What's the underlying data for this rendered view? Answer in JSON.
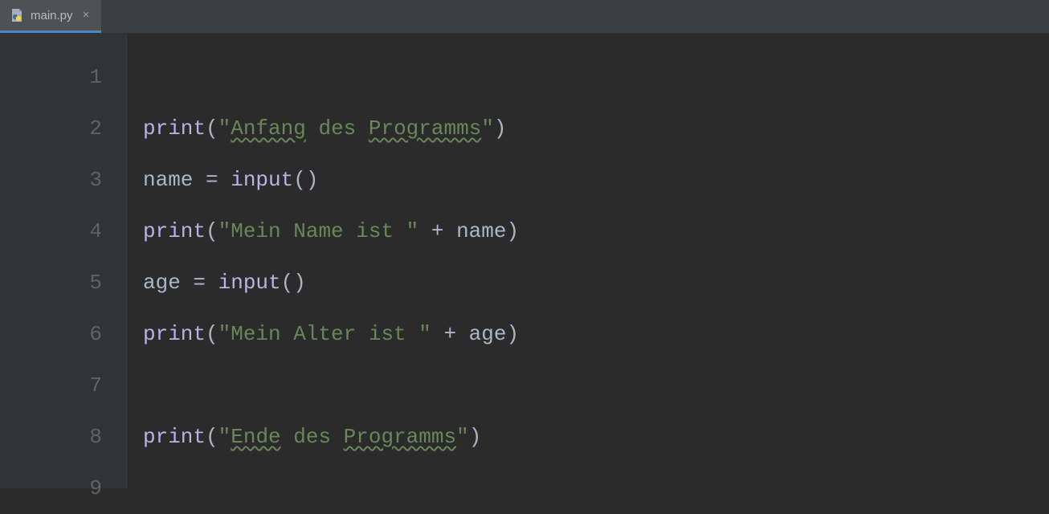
{
  "tab": {
    "filename": "main.py",
    "close_glyph": "×"
  },
  "gutter": {
    "numbers": [
      "1",
      "2",
      "3",
      "4",
      "5",
      "6",
      "7",
      "8",
      "9"
    ]
  },
  "code": {
    "lines": [
      {
        "tokens": []
      },
      {
        "tokens": [
          {
            "t": "print",
            "c": "tok-fn"
          },
          {
            "t": "(",
            "c": "tok-op"
          },
          {
            "t": "\"",
            "c": "tok-str"
          },
          {
            "t": "Anfang",
            "c": "tok-str typo"
          },
          {
            "t": " des ",
            "c": "tok-str"
          },
          {
            "t": "Programms",
            "c": "tok-str typo"
          },
          {
            "t": "\"",
            "c": "tok-str"
          },
          {
            "t": ")",
            "c": "tok-op"
          }
        ]
      },
      {
        "tokens": [
          {
            "t": "name = ",
            "c": "tok-op"
          },
          {
            "t": "input",
            "c": "tok-fn"
          },
          {
            "t": "()",
            "c": "tok-op"
          }
        ]
      },
      {
        "tokens": [
          {
            "t": "print",
            "c": "tok-fn"
          },
          {
            "t": "(",
            "c": "tok-op"
          },
          {
            "t": "\"Mein Name ist \"",
            "c": "tok-str"
          },
          {
            "t": " + name)",
            "c": "tok-op"
          }
        ]
      },
      {
        "tokens": [
          {
            "t": "age = ",
            "c": "tok-op"
          },
          {
            "t": "input",
            "c": "tok-fn"
          },
          {
            "t": "()",
            "c": "tok-op"
          }
        ]
      },
      {
        "tokens": [
          {
            "t": "print",
            "c": "tok-fn"
          },
          {
            "t": "(",
            "c": "tok-op"
          },
          {
            "t": "\"Mein Alter ist \"",
            "c": "tok-str"
          },
          {
            "t": " + age)",
            "c": "tok-op"
          }
        ]
      },
      {
        "tokens": []
      },
      {
        "tokens": [
          {
            "t": "print",
            "c": "tok-fn"
          },
          {
            "t": "(",
            "c": "tok-op"
          },
          {
            "t": "\"",
            "c": "tok-str"
          },
          {
            "t": "Ende",
            "c": "tok-str typo"
          },
          {
            "t": " des ",
            "c": "tok-str"
          },
          {
            "t": "Programms",
            "c": "tok-str typo"
          },
          {
            "t": "\"",
            "c": "tok-str"
          },
          {
            "t": ")",
            "c": "tok-op"
          }
        ]
      },
      {
        "tokens": []
      }
    ]
  }
}
